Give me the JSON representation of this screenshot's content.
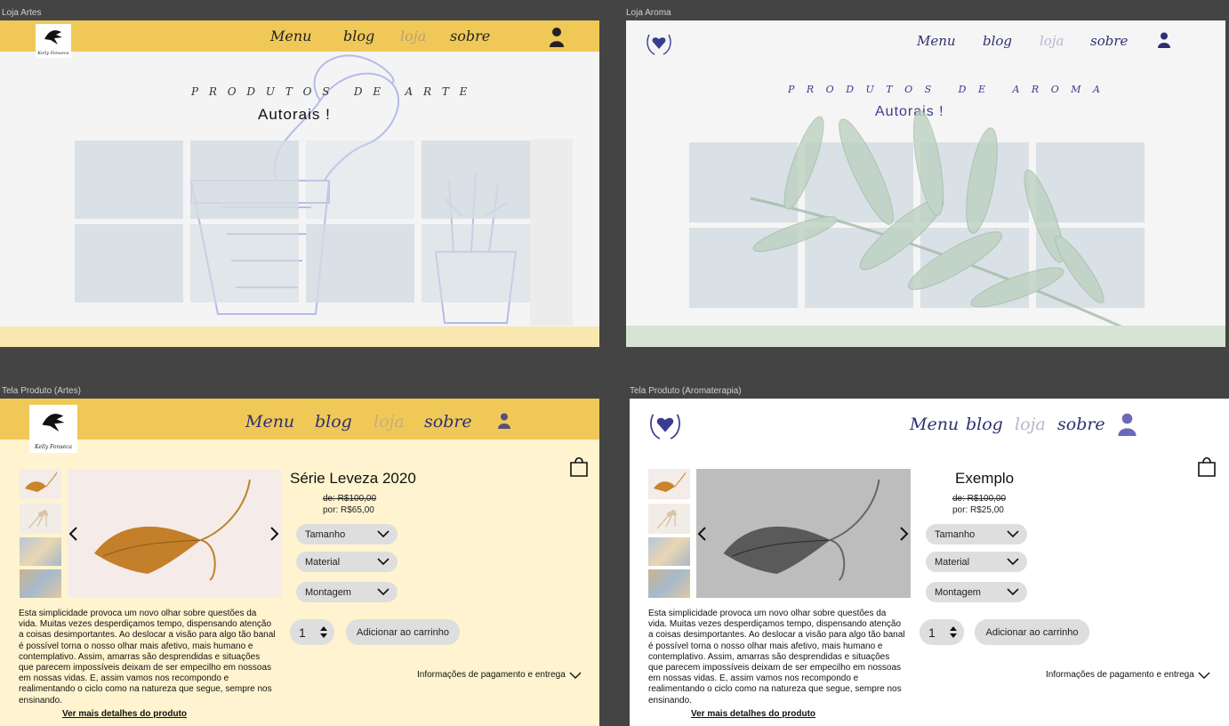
{
  "frames": {
    "artes_store_label": "Loja Artes",
    "aroma_store_label": "Loja Aroma",
    "artes_product_label": "Tela Produto (Artes)",
    "aroma_product_label": "Tela Produto (Aromaterapia)"
  },
  "nav": {
    "menu": "Menu",
    "blog": "blog",
    "loja": "loja",
    "sobre": "sobre"
  },
  "logo_text": "Kelly Fonseca",
  "artes_store": {
    "heading": "P R O D U T O S   D E   A R T E",
    "subheading": "Autorais !"
  },
  "aroma_store": {
    "heading": "P R O D U T O S   D E   A R O M A",
    "subheading": "Autorais !"
  },
  "artes_product": {
    "title": "Série Leveza 2020",
    "old_price": "de: R$100,00",
    "new_price": "por: R$65,00"
  },
  "aroma_product": {
    "title": "Exemplo",
    "old_price": "de: R$100,00",
    "new_price": "por: R$25,00"
  },
  "product_common": {
    "option_size": "Tamanho",
    "option_material": "Material",
    "option_mount": "Montagem",
    "quantity": "1",
    "add_to_cart": "Adicionar ao carrinho",
    "payment_info": "Informações de pagamento e entrega",
    "description": "Esta simplicidade provoca um novo olhar sobre questões da vida. Muitas vezes desperdiçamos tempo, dispensando atenção a coisas desimportantes. Ao deslocar a visão para algo tão banal é possível torna o nosso olhar mais afetivo, mais humano e contemplativo. Assim, amarras são desprendidas e situações que parecem impossíveis deixam de ser empecilho em nossoas em nossas vidas. E, assim vamos nos recompondo e realimentando o ciclo como na natureza que segue, sempre nos ensinando.",
    "details_link": "Ver mais detalhes do produto"
  },
  "colors": {
    "canvas": "#444444",
    "artes_header": "#f0c857",
    "artes_bg": "#fff4cf",
    "aroma_accent": "#3a3d8f",
    "aroma_band": "#d7e3d4",
    "nav_dark": "#2e3170",
    "nav_faded": "#b7b5cf"
  },
  "icons": [
    "user-icon",
    "bag-icon",
    "chevron-down-icon",
    "chevron-left-icon",
    "chevron-right-icon",
    "heart-wreath-logo-icon",
    "spinner-arrows-icon"
  ]
}
